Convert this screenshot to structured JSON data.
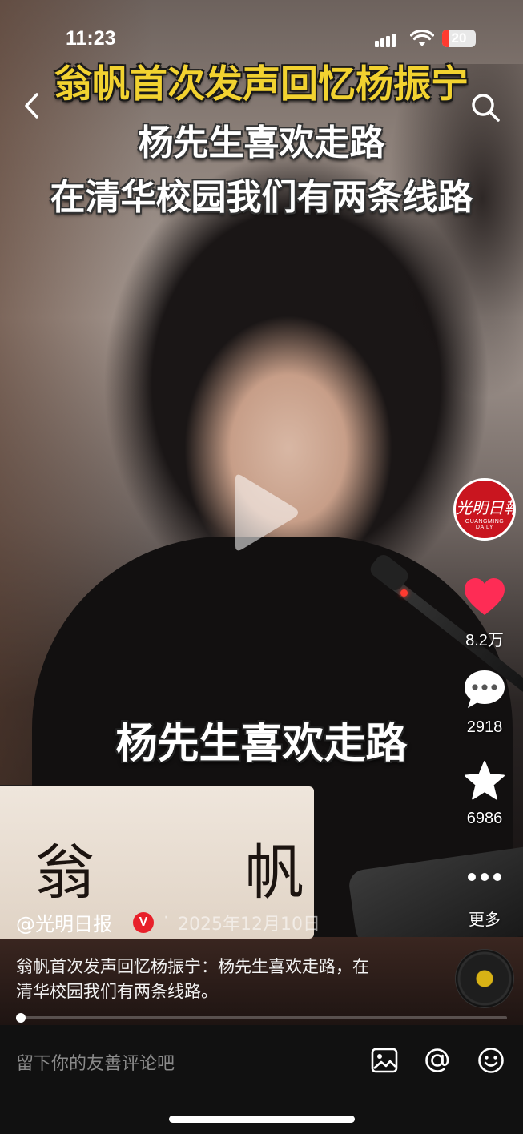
{
  "status_bar": {
    "time": "11:23",
    "battery": "20",
    "battery_level": 0.2
  },
  "headline": {
    "line1": "翁帆首次发声回忆杨振宁",
    "line2": "杨先生喜欢走路",
    "line3": "在清华校园我们有两条线路"
  },
  "subtitle": "杨先生喜欢走路",
  "nameplate": "翁 帆",
  "account": {
    "handle": "@光明日报",
    "verified_badge": "V",
    "dot": "·",
    "date": "2025年12月10日",
    "avatar_logo": "光明日報",
    "avatar_logo_en": "GUANGMING DAILY"
  },
  "description": "翁帆首次发声回忆杨振宁：杨先生喜欢走路，在清华校园我们有两条线路。",
  "actions": {
    "likes": "8.2万",
    "comments": "2918",
    "favorites": "6986",
    "more": "更多"
  },
  "progress": {
    "fraction": 0.01
  },
  "comment_bar": {
    "placeholder": "留下你的友善评论吧"
  },
  "icons": [
    "back-chevron-icon",
    "search-icon",
    "play-icon",
    "heart-icon",
    "comment-icon",
    "star-icon",
    "more-icon",
    "image-icon",
    "at-icon",
    "emoji-icon"
  ],
  "colors": {
    "headline_yellow": "#f2d230",
    "like_red": "#fe2c55",
    "verified_red": "#e8202a",
    "battery_red": "#ff3b30"
  }
}
